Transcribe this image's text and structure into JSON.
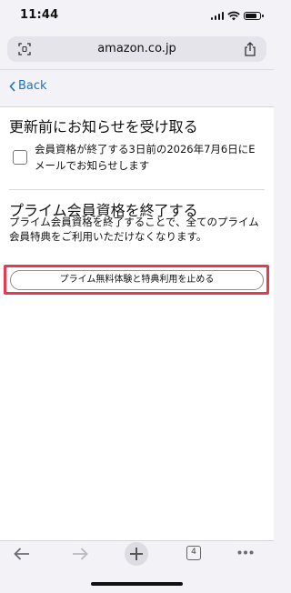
{
  "status_bar": {
    "time": "11:44",
    "battery_level": 0.8
  },
  "browser": {
    "url": "amazon.co.jp"
  },
  "nav": {
    "back_label": "Back"
  },
  "renewal_section": {
    "title": "更新前にお知らせを受け取る",
    "checkbox_label": "会員資格が終了する3日前の2026年7月6日にEメールでお知らせします",
    "checked": false
  },
  "prime_section": {
    "title": "プライム会員資格を終了する",
    "description": "プライム会員資格を終了することで、全てのプライム会員特典をご利用いただけなくなります。",
    "cancel_button_label": "プライム無料体験と特典利用を止める"
  },
  "toolbar": {
    "tab_count": "4"
  },
  "colors": {
    "link": "#1b74c8",
    "highlight": "#e53b4f"
  }
}
